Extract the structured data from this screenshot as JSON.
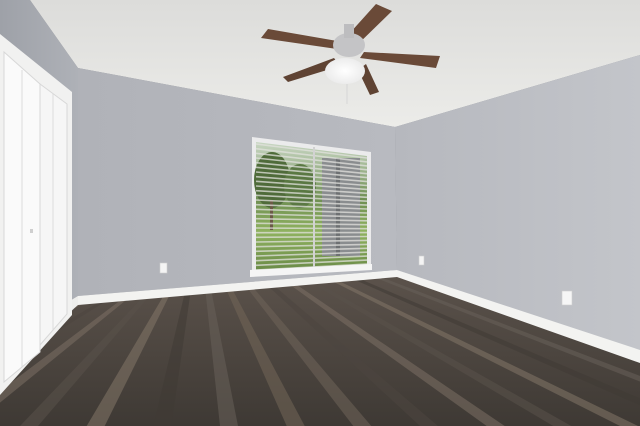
{
  "scene": {
    "subject": "empty-bedroom",
    "features": [
      "textured-ceiling",
      "ceiling-fan",
      "bifold-closet-doors",
      "window-with-blinds",
      "wood-plank-floor",
      "white-baseboards",
      "outlets"
    ]
  },
  "colors": {
    "ceiling": "#e4e4e2",
    "wall_left": "#a4a7ae",
    "wall_back": "#b3b5bb",
    "wall_right": "#bcbec4",
    "floor_dark": "#4a4540",
    "floor_light": "#7b6f64",
    "baseboard": "#f4f4f2",
    "fan_blade": "#6a4a38",
    "fan_housing": "#c9c9cb",
    "window_frame": "#e9e9ea",
    "blinds": "#d9d9d7",
    "lawn": "#7ea35a"
  }
}
